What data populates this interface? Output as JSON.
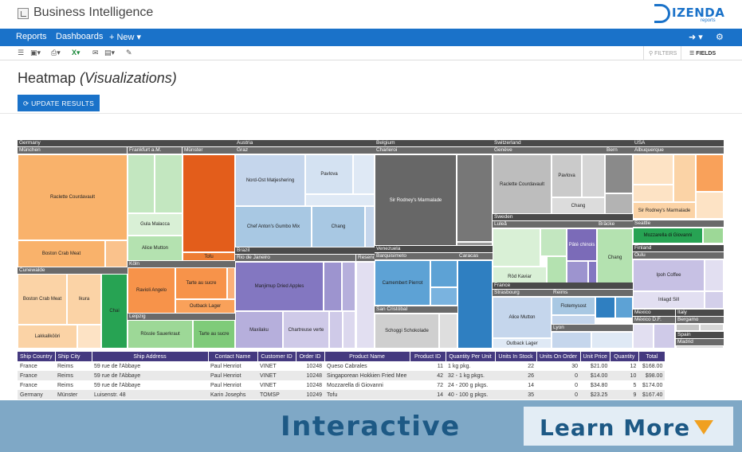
{
  "app": {
    "title": "Business Intelligence",
    "brand": "IZENDA",
    "brand_sub": "reports"
  },
  "nav": {
    "reports": "Reports",
    "dashboards": "Dashboards",
    "new": "+ New ▾",
    "login_icon": "➜ ▾",
    "settings_icon": "⚙"
  },
  "toolbar": {
    "filters": "FILTERS",
    "fields": "FIELDS"
  },
  "page": {
    "title_main": "Heatmap ",
    "title_em": "(Visualizations)",
    "update_button": "UPDATE RESULTS"
  },
  "colors": {
    "accent": "#1a72c9",
    "header_band": "#44397f",
    "banner": "#7fa8c6",
    "banner_text": "#1d5985",
    "arrow": "#f0a020"
  },
  "heatmap": {
    "headers": {
      "germany": "Germany",
      "austria": "Austria",
      "belgium": "Belgium",
      "switzerland": "Switzerland",
      "usa": "USA",
      "munchen": "München",
      "frankfurt": "Frankfurt a.M.",
      "munster": "Münster",
      "graz": "Graz",
      "charleroi": "Charleroi",
      "geneve": "Genève",
      "bern": "Bern",
      "albuquerque": "Albuquerque",
      "cunewalde": "Cunewalde",
      "koln": "Köln",
      "leipzig": "Leipzig",
      "brazil": "Brazil",
      "rio": "Rio de Janeiro",
      "resende": "Resende",
      "venezuela": "Venezuela",
      "barquisimeto": "Barquisimeto",
      "caracas": "Caracas",
      "sancristobal": "San Cristóbal",
      "sweden": "Sweden",
      "lulea": "Luleå",
      "bracke": "Bräcke",
      "france": "France",
      "strasbourg": "Strasbourg",
      "reims": "Reims",
      "lyon": "Lyon",
      "seattle": "Seattle",
      "finland": "Finland",
      "oulu": "Oulu",
      "mexico": "Mexico",
      "mexicodf": "México D.F.",
      "italy": "Italy",
      "bergamo": "Bergamo",
      "spain": "Spain",
      "madrid": "Madrid"
    },
    "tiles": {
      "raclette_de": "Raclette Courdavault",
      "boston_de": "Boston Crab Meat",
      "gula": "Gula Malacca",
      "alice_de": "Alice Mutton",
      "tofu": "Tofu",
      "nordost": "Nord-Ost Matjeshering",
      "pavlova_at": "Pavlova",
      "gumbo": "Chef Anton's Gumbo Mix",
      "chang_at": "Chang",
      "marmalade_be": "Sir Rodney's Marmalade",
      "raclette_ch": "Raclette Courdavault",
      "pavlova_ch": "Pavlova",
      "chang_ch": "Chang",
      "marmalade_us": "Sir Rodney's Marmalade",
      "boston_cw": "Boston Crab Meat",
      "ikura": "Ikura",
      "chai": "Chai",
      "lakkalikoori": "Lakkalikööri",
      "ravioli": "Ravioli Angelo",
      "tarte_koln": "Tarte au sucre",
      "outback_koln": "Outback Lager",
      "rossle": "Rössle Sauerkraut",
      "tarte_leip": "Tarte au sucre",
      "manjimup": "Manjimup Dried Apples",
      "maxilaku": "Maxilaku",
      "chartreuse": "Chartreuse verte",
      "camembert": "Camembert Pierrot",
      "schoggi": "Schoggi Schokolade",
      "pate": "Pâté chinois",
      "rodkaviar": "Röd Kaviar",
      "chang_se": "Chang",
      "alice_fr": "Alice Mutton",
      "outback_fr": "Outback Lager",
      "flotemysost": "Flotemysost",
      "mozzarella_us": "Mozzarella di Giovanni",
      "ipoh": "Ipoh Coffee",
      "inlagd": "Inlagd Sill"
    }
  },
  "table": {
    "headers": [
      "Ship Country",
      "Ship City",
      "Ship Address",
      "Contact Name",
      "Customer ID",
      "Order ID",
      "Product Name",
      "Product ID",
      "Quantity Per Unit",
      "Units In Stock",
      "Units On Order",
      "Unit Price",
      "Quantity",
      "Total"
    ],
    "rows": [
      [
        "France",
        "Reims",
        "59 rue de l'Abbaye",
        "Paul Henriot",
        "VINET",
        "10248",
        "Queso Cabrales",
        "11",
        "1 kg pkg.",
        "22",
        "30",
        "$21.00",
        "12",
        "$168.00"
      ],
      [
        "France",
        "Reims",
        "59 rue de l'Abbaye",
        "Paul Henriot",
        "VINET",
        "10248",
        "Singaporean Hokkien Fried Mee",
        "42",
        "32 - 1 kg pkgs.",
        "26",
        "0",
        "$14.00",
        "10",
        "$98.00"
      ],
      [
        "France",
        "Reims",
        "59 rue de l'Abbaye",
        "Paul Henriot",
        "VINET",
        "10248",
        "Mozzarella di Giovanni",
        "72",
        "24 - 200 g pkgs.",
        "14",
        "0",
        "$34.80",
        "5",
        "$174.00"
      ],
      [
        "Germany",
        "Münster",
        "Luisenstr. 48",
        "Karin Josephs",
        "TOMSP",
        "10249",
        "Tofu",
        "14",
        "40 - 100 g pkgs.",
        "35",
        "0",
        "$23.25",
        "9",
        "$167.40"
      ]
    ]
  },
  "banner": {
    "text": "Interactive",
    "cta": "Learn More"
  }
}
